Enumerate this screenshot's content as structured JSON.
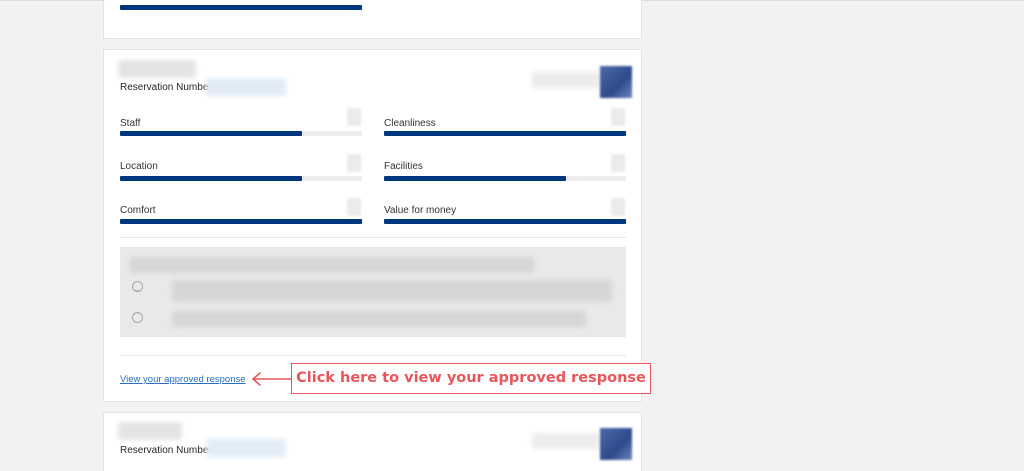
{
  "colors": {
    "bar": "#003580",
    "bar_track": "#ececec",
    "link": "#2a6fbf",
    "callout": "#e8565c",
    "page_bg": "#f2f2f2"
  },
  "main_review": {
    "reservation_label": "Reservation Number",
    "ratings": [
      {
        "label": "Staff",
        "level": 0.75
      },
      {
        "label": "Cleanliness",
        "level": 1.0
      },
      {
        "label": "Location",
        "level": 0.75
      },
      {
        "label": "Facilities",
        "level": 0.75
      },
      {
        "label": "Comfort",
        "level": 1.0
      },
      {
        "label": "Value for money",
        "level": 1.0
      }
    ],
    "comment_icons": [
      "smile-icon",
      "frown-icon"
    ],
    "view_response_link": "View your approved response"
  },
  "callout": {
    "text": "Click here to view your approved response",
    "icon": "arrow-left-icon"
  },
  "next_review": {
    "reservation_label": "Reservation Number"
  }
}
